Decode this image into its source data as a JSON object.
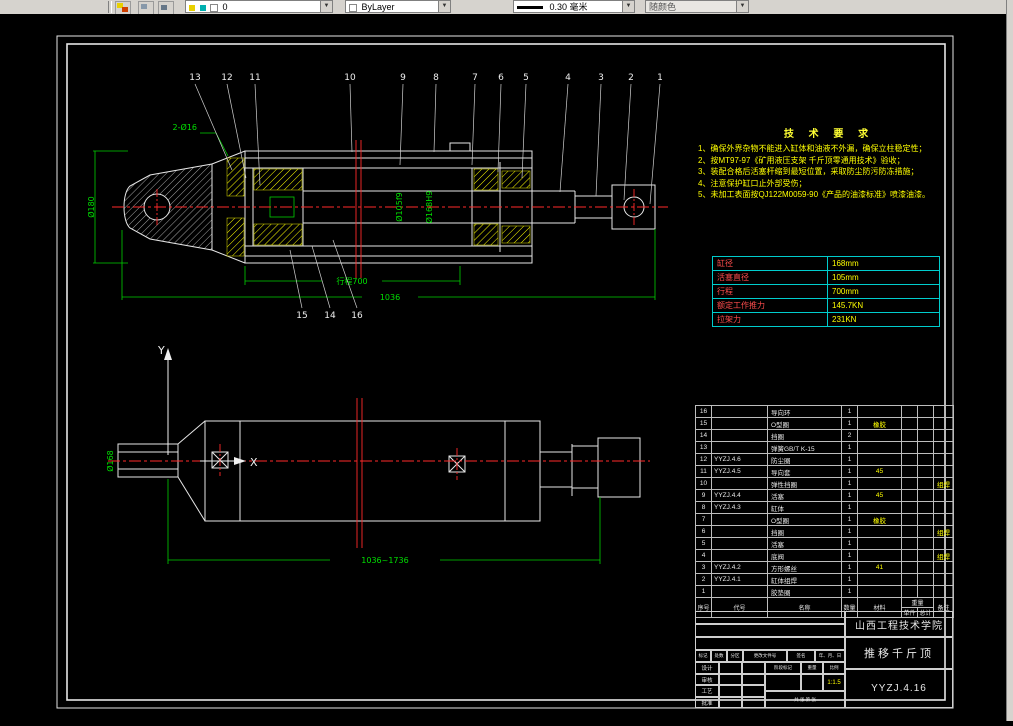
{
  "toolbar": {
    "layer_value": "0",
    "color_value": "ByLayer",
    "lineweight_value": "0.30 毫米",
    "plotstyle_value": "随颜色",
    "dropdown_glyph": "▼"
  },
  "tech_requirements": {
    "title": "技 术 要 求",
    "lines": [
      "1、确保外界杂物不能进入缸体和油液不外漏，确保立柱稳定性；",
      "2、按MT97-97《矿用液压支架 千斤顶零通用技术》验收；",
      "3、装配合格后活塞杆缩到最短位置，采取防尘防污防冻措施；",
      "4、注意保护缸口止外部受伤；",
      "5、未加工表面按QJ122M0059-90《产品的油漆标准》喷漆油漆。"
    ]
  },
  "param_table": {
    "rows": [
      {
        "label": "缸径",
        "value": "168mm"
      },
      {
        "label": "活塞直径",
        "value": "105mm"
      },
      {
        "label": "行程",
        "value": "700mm"
      },
      {
        "label": "额定工作推力",
        "value": "145.7KN"
      },
      {
        "label": "拉架力",
        "value": "231KN"
      }
    ]
  },
  "bom": {
    "headers": {
      "no": "序号",
      "code": "代号",
      "name": "名称",
      "qty": "数量",
      "material": "材料",
      "weight": "重量",
      "unit": "单件",
      "total": "总计",
      "note": "备注"
    },
    "rows": [
      {
        "no": "16",
        "code": "",
        "name": "导向环",
        "qty": "1",
        "material": "",
        "unit": "",
        "total": "",
        "note": ""
      },
      {
        "no": "15",
        "code": "",
        "name": "O型圈",
        "qty": "1",
        "material": "橡胶",
        "unit": "",
        "total": "",
        "note": ""
      },
      {
        "no": "14",
        "code": "",
        "name": "挡圈",
        "qty": "2",
        "material": "",
        "unit": "",
        "total": "",
        "note": ""
      },
      {
        "no": "13",
        "code": "",
        "name": "弹簧GB/T K-15",
        "qty": "1",
        "material": "",
        "unit": "",
        "total": "",
        "note": ""
      },
      {
        "no": "12",
        "code": "YYZJ.4.6",
        "name": "防尘圈",
        "qty": "1",
        "material": "",
        "unit": "",
        "total": "",
        "note": ""
      },
      {
        "no": "11",
        "code": "YYZJ.4.5",
        "name": "导向套",
        "qty": "1",
        "material": "45",
        "unit": "",
        "total": "",
        "note": ""
      },
      {
        "no": "10",
        "code": "",
        "name": "弹性挡圈",
        "qty": "1",
        "material": "",
        "unit": "",
        "total": "",
        "note": "组焊"
      },
      {
        "no": "9",
        "code": "YYZJ.4.4",
        "name": "活塞",
        "qty": "1",
        "material": "45",
        "unit": "",
        "total": "",
        "note": ""
      },
      {
        "no": "8",
        "code": "YYZJ.4.3",
        "name": "缸体",
        "qty": "1",
        "material": "",
        "unit": "",
        "total": "",
        "note": ""
      },
      {
        "no": "7",
        "code": "",
        "name": "O型圈",
        "qty": "1",
        "material": "橡胶",
        "unit": "",
        "total": "",
        "note": ""
      },
      {
        "no": "6",
        "code": "",
        "name": "挡圈",
        "qty": "1",
        "material": "",
        "unit": "",
        "total": "",
        "note": "组焊"
      },
      {
        "no": "5",
        "code": "",
        "name": "活塞",
        "qty": "1",
        "material": "",
        "unit": "",
        "total": "",
        "note": ""
      },
      {
        "no": "4",
        "code": "",
        "name": "底阀",
        "qty": "1",
        "material": "",
        "unit": "",
        "total": "",
        "note": "组焊"
      },
      {
        "no": "3",
        "code": "YYZJ.4.2",
        "name": "方形螺丝",
        "qty": "1",
        "material": "41",
        "unit": "",
        "total": "",
        "note": ""
      },
      {
        "no": "2",
        "code": "YYZJ.4.1",
        "name": "缸体组焊",
        "qty": "1",
        "material": "",
        "unit": "",
        "total": "",
        "note": ""
      },
      {
        "no": "1",
        "code": "",
        "name": "胶垫圈",
        "qty": "1",
        "material": "",
        "unit": "",
        "total": "",
        "note": ""
      }
    ]
  },
  "title_block": {
    "school": "山西工程技术学院",
    "drawing_title": "推移千斤顶",
    "drawing_no": "YYZJ.4.16",
    "scale_value": "1:1.5",
    "labels": {
      "mark": "标记",
      "count": "处数",
      "zone": "分区",
      "change_file": "更改文件号",
      "sign": "签名",
      "date": "年、月、日",
      "design": "设计",
      "check": "审核",
      "process": "工艺",
      "standard": "标准化",
      "approve": "批准",
      "stage": "阶段标记",
      "weight": "重量",
      "scale": "比例",
      "sheet": "共  张  第  张"
    }
  },
  "callouts": {
    "top": [
      "13",
      "12",
      "11",
      "10",
      "9",
      "8",
      "7",
      "6",
      "5",
      "4",
      "3",
      "2",
      "1"
    ],
    "bottom": [
      "15",
      "14",
      "16"
    ]
  },
  "dims": {
    "lug_od": "Ø180",
    "lug_holes": "2-Ø16",
    "rod_dia": "Ø105f9",
    "bore_dia": "Ø168H9",
    "stroke_dim": "行程700",
    "overall_main": "1036",
    "overall_range": "1036~1736",
    "body_od": "Ø168"
  },
  "axis": {
    "x": "X",
    "y": "Y"
  }
}
